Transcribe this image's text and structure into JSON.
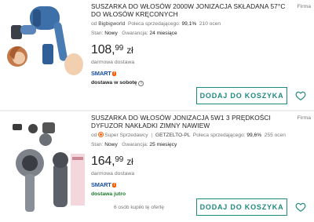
{
  "listings": [
    {
      "title": "SUSZARKA DO WŁOSÓW 2000W JONIZACJA SKŁADANA 57°C DO WŁOSÓW KRĘCONYCH",
      "seller_prefix": "od",
      "seller": "Bigbigworld",
      "recommend_label": "Poleca sprzedającego:",
      "recommend_value": "99,1%",
      "reviews": "210 ocen",
      "condition_label": "Stan:",
      "condition_value": "Nowy",
      "warranty_label": "Gwarancja:",
      "warranty_value": "24 miesiące",
      "price_int": "108,",
      "price_cents": "99",
      "price_currency": "zł",
      "delivery": "darmowa dostawa",
      "smart_label": "SMART",
      "smart_badge": "!",
      "shipping": "dostawa w sobotę",
      "shipping_info_icon": "info-icon",
      "firma": "Firma",
      "cart_label": "DODAJ DO KOSZYKA",
      "heart_icon": "heart-icon"
    },
    {
      "title": "SUSZARKA DO WŁOSÓW JONIZACJA 5w1 3 PRĘDKOŚCI DYFUZOR NAKŁADKI ZIMNY NAWIEW",
      "seller_prefix": "od",
      "super_seller": "Super Sprzedawcy",
      "seller_sep": "|",
      "seller": "GETZELTO-PL",
      "recommend_label": "Poleca sprzedającego:",
      "recommend_value": "99,6%",
      "reviews": "255 ocen",
      "condition_label": "Stan:",
      "condition_value": "Nowy",
      "warranty_label": "Gwarancja:",
      "warranty_value": "25 miesięcy",
      "price_int": "164,",
      "price_cents": "99",
      "price_currency": "zł",
      "delivery": "darmowa dostawa",
      "smart_label": "SMART",
      "smart_badge": "!",
      "shipping": "dostawa jutro",
      "bought": "6 osób kupiło tę ofertę",
      "firma": "Firma",
      "cart_label": "DODAJ DO KOSZYKA",
      "heart_icon": "heart-icon"
    }
  ],
  "colors": {
    "accent": "#1f8a7f",
    "smart_blue": "#1a4fa0",
    "smart_orange": "#ff5a00",
    "delivery_green": "#1a7a2a"
  }
}
